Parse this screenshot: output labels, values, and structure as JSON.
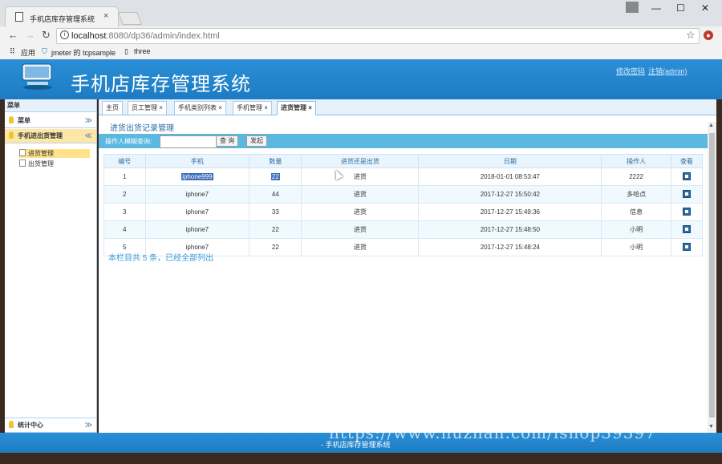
{
  "browser": {
    "tab_title": "手机店库存管理系统",
    "tab_close": "×",
    "url_host": "localhost",
    "url_rest": ":8080/dp36/admin/index.html",
    "bookmarks": [
      "应用",
      "jmeter 的 tcpsample",
      "three"
    ],
    "window_controls": [
      "—",
      "☐",
      "✕"
    ]
  },
  "app": {
    "title": "手机店库存管理系统",
    "top_links": [
      "修改密码",
      "注销(admin)"
    ]
  },
  "sidebar": {
    "header": "菜单",
    "panels": [
      {
        "label": "菜单",
        "chev": "≫"
      },
      {
        "label": "手机进出货管理",
        "chev": "≪"
      }
    ],
    "items": [
      {
        "label": "进货管理",
        "selected": true
      },
      {
        "label": "出货管理",
        "selected": false
      }
    ],
    "bottom_panel": {
      "label": "统计中心",
      "chev": "≫"
    }
  },
  "tabs": [
    {
      "label": "主页",
      "closable": false
    },
    {
      "label": "员工管理",
      "closable": true
    },
    {
      "label": "手机类别列表",
      "closable": true
    },
    {
      "label": "手机管理",
      "closable": true
    },
    {
      "label": "进货管理",
      "closable": true,
      "active": true
    }
  ],
  "main": {
    "section_title": "进货出货记录管理",
    "search_label": "操作人模糊查询:",
    "search_value": "",
    "query_button": "查 询",
    "reset_button": "发起",
    "columns": [
      "编号",
      "手机",
      "数量",
      "进货还是出货",
      "日期",
      "操作人",
      "查看"
    ],
    "rows": [
      [
        "1",
        "iphone999",
        "22",
        "进货",
        "2018-01-01 08:53:47",
        "2222"
      ],
      [
        "2",
        "iphone7",
        "44",
        "进货",
        "2017-12-27 15:50:42",
        "多哈点"
      ],
      [
        "3",
        "iphone7",
        "33",
        "进货",
        "2017-12-27 15:49:36",
        "信息"
      ],
      [
        "4",
        "iphone7",
        "22",
        "进货",
        "2017-12-27 15:48:50",
        "小明"
      ],
      [
        "5",
        "iphone7",
        "22",
        "进货",
        "2017-12-27 15:48:24",
        "小明"
      ]
    ],
    "footnote": "本栏目共 5 条，已经全部列出"
  },
  "footer": {
    "text": "- 手机店库存管理系统"
  },
  "watermark": "https://www.huzhan.com/ishop39397",
  "colors": {
    "header_blue": "#1d7bc3",
    "bar_blue": "#5bb9df",
    "link_blue": "#3a9ad9"
  }
}
